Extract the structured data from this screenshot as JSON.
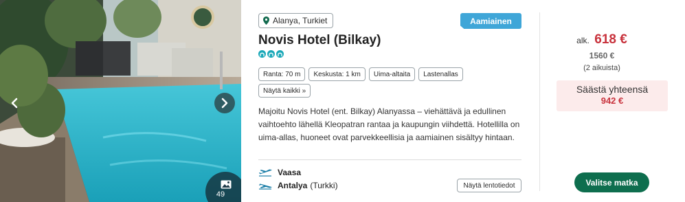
{
  "gallery": {
    "photo_count": "49"
  },
  "location": {
    "label": "Alanya, Turkiet"
  },
  "meal_badge": "Aamiainen",
  "hotel": {
    "name": "Novis Hotel (Bilkay)",
    "rating": 3
  },
  "tags": [
    {
      "label": "Ranta: 70 m"
    },
    {
      "label": "Keskusta: 1 km"
    },
    {
      "label": "Uima-altaita"
    },
    {
      "label": "Lastenallas"
    }
  ],
  "show_all_label": "Näytä kaikki »",
  "description": "Majoitu Novis Hotel (ent. Bilkay) Alanyassa – viehättävä ja edullinen vaihtoehto lähellä Kleopatran rantaa ja kaupungin viihdettä. Hotellilla on uima-allas, huoneet ovat parvekkeellisia ja aamiainen sisältyy hintaan.",
  "flights": {
    "departure": {
      "city": "Vaasa",
      "country": ""
    },
    "arrival": {
      "city": "Antalya",
      "country": "(Turkki)"
    },
    "details_label": "Näytä lentotiedot"
  },
  "price": {
    "prefix": "alk.",
    "amount": "618 €",
    "original": "1560 €",
    "travelers": "(2 aikuista)",
    "savings_label": "Säästä yhteensä",
    "savings_amount": "942 €"
  },
  "cta_label": "Valitse matka",
  "colors": {
    "accent_red": "#c8323c",
    "meal_badge": "#3fa6d8",
    "cta_green": "#0e6e4e",
    "rating_teal": "#1aa8b8",
    "savings_bg": "#fcebeb"
  }
}
